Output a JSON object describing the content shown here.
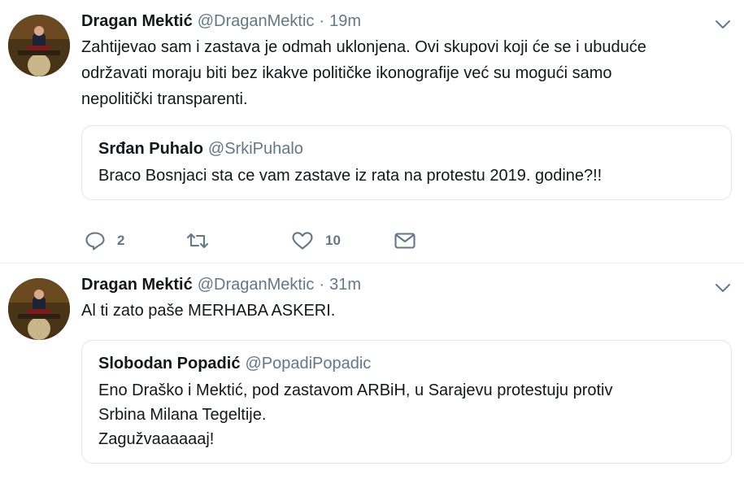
{
  "tweets": [
    {
      "author_name": "Dragan Mektić",
      "author_handle": "@DraganMektic",
      "separator": "·",
      "time": "19m",
      "text_lines": [
        "Zahtijevao sam i zastava je odmah uklonjena. Ovi skupovi koji će se i ubuduće",
        "održavati moraju biti bez ikakve političke ikonografije već su mogući samo",
        "nepolitički transparenti."
      ],
      "quote": {
        "author_name": "Srđan Puhalo",
        "author_handle": "@SrkiPuhalo",
        "text_lines": [
          "Braco Bosnjaci sta ce vam zastave iz rata na protestu 2019. godine?!!"
        ]
      },
      "actions": {
        "reply_icon": "reply-icon",
        "reply_count": "2",
        "retweet_icon": "retweet-icon",
        "like_icon": "heart-icon",
        "like_count": "10",
        "message_icon": "envelope-icon"
      }
    },
    {
      "author_name": "Dragan Mektić",
      "author_handle": "@DraganMektic",
      "separator": "·",
      "time": "31m",
      "text_lines": [
        "Al ti zato paše MERHABA ASKERI."
      ],
      "quote": {
        "author_name": "Slobodan Popadić",
        "author_handle": "@PopadiPopadic",
        "text_lines": [
          "Eno Draško i Mektić, pod zastavom ARBiH, u Sarajevu protestuju protiv",
          "Srbina Milana Tegeltije.",
          "Zagužvaaaaaaj!"
        ]
      }
    }
  ],
  "colors": {
    "text": "#14171a",
    "secondary": "#657786",
    "border": "#e1e8ed"
  }
}
